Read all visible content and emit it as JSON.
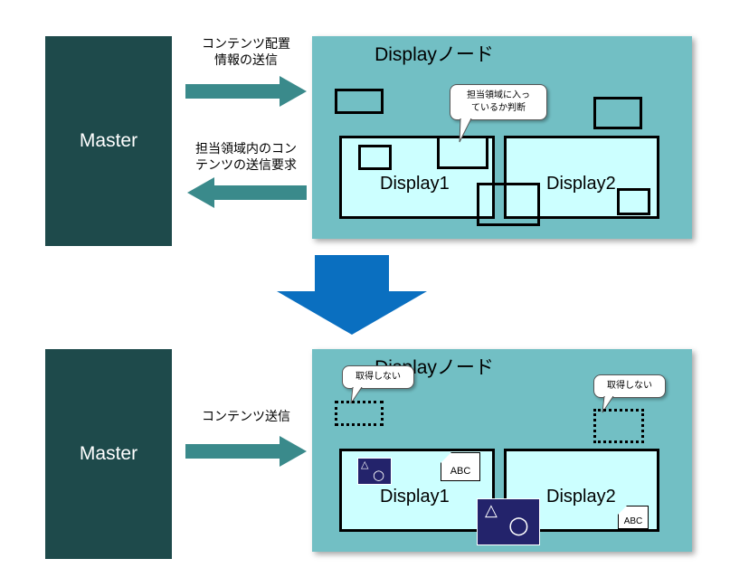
{
  "top": {
    "master_label": "Master",
    "send_label_line1": "コンテンツ配置",
    "send_label_line2": "情報の送信",
    "request_label_line1": "担当領域内のコン",
    "request_label_line2": "テンツの送信要求",
    "node_title": "Displayノード",
    "bubble_line1": "担当領域に入っ",
    "bubble_line2": "ているか判断",
    "display1": "Display1",
    "display2": "Display2"
  },
  "bottom": {
    "master_label": "Master",
    "send_label": "コンテンツ送信",
    "node_title": "Displayノード",
    "bubble_left": "取得しない",
    "bubble_right": "取得しない",
    "display1": "Display1",
    "display2": "Display2",
    "abc_1": "ABC",
    "abc_2": "ABC",
    "shape_triangle": "△",
    "shape_circle": "○"
  },
  "colors": {
    "master_bg": "#1e4a4b",
    "node_bg": "#72bfc4",
    "arrow": "#3a8a8b",
    "down_arrow": "#0a6fc0",
    "display_bg": "#ccffff",
    "content_pic": "#23236b"
  }
}
